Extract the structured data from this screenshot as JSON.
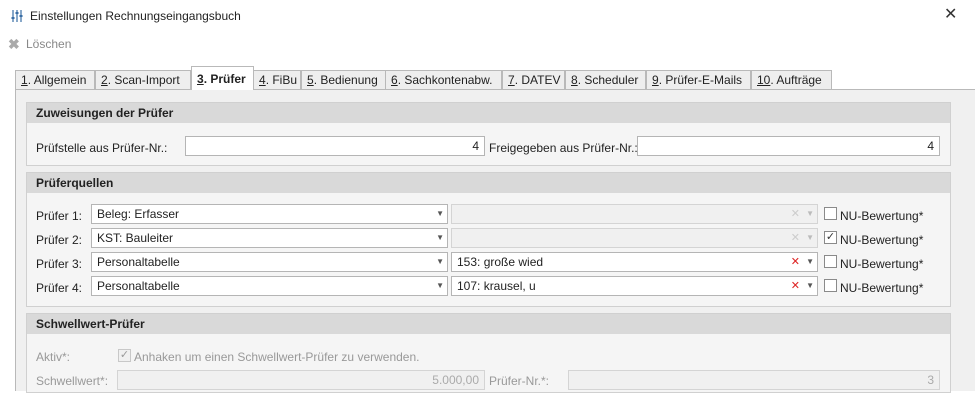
{
  "window": {
    "title": "Einstellungen Rechnungseingangsbuch",
    "title_icon": "settings-sliders-icon",
    "close_icon": "close-icon"
  },
  "toolbar": {
    "delete_label": "Löschen",
    "delete_icon": "close-x-icon"
  },
  "tabs": [
    {
      "key": "1",
      "rest": ". Allgemein",
      "active": false
    },
    {
      "key": "2",
      "rest": ". Scan-Import",
      "active": false
    },
    {
      "key": "3",
      "rest": ". Prüfer",
      "active": true
    },
    {
      "key": "4",
      "rest": ". FiBu",
      "active": false
    },
    {
      "key": "5",
      "rest": ". Bedienung",
      "active": false
    },
    {
      "key": "6",
      "rest": ". Sachkontenabw.",
      "active": false
    },
    {
      "key": "7",
      "rest": ". DATEV",
      "active": false
    },
    {
      "key": "8",
      "rest": ". Scheduler",
      "active": false
    },
    {
      "key": "9",
      "rest": ". Prüfer-E-Mails",
      "active": false
    },
    {
      "key": "10",
      "rest": ". Aufträge",
      "active": false
    }
  ],
  "zuweisungen": {
    "header": "Zuweisungen der Prüfer",
    "pruefstelle_label": "Prüfstelle aus Prüfer-Nr.:",
    "pruefstelle_value": "4",
    "freigegeben_label": "Freigegeben aus Prüfer-Nr.:",
    "freigegeben_value": "4"
  },
  "pruefquellen": {
    "header": "Prüferquellen",
    "rows": [
      {
        "label": "Prüfer 1:",
        "source": "Beleg: Erfasser",
        "value": "",
        "value_enabled": false,
        "nu_label": "NU-Bewertung*",
        "nu_checked": false
      },
      {
        "label": "Prüfer 2:",
        "source": "KST: Bauleiter",
        "value": "",
        "value_enabled": false,
        "nu_label": "NU-Bewertung*",
        "nu_checked": true
      },
      {
        "label": "Prüfer 3:",
        "source": "Personaltabelle",
        "value": "153: große wied",
        "value_enabled": true,
        "nu_label": "NU-Bewertung*",
        "nu_checked": false
      },
      {
        "label": "Prüfer 4:",
        "source": "Personaltabelle",
        "value": "107: krausel, u",
        "value_enabled": true,
        "nu_label": "NU-Bewertung*",
        "nu_checked": false
      }
    ]
  },
  "schwellwert": {
    "header": "Schwellwert-Prüfer",
    "aktiv_label": "Aktiv*:",
    "aktiv_checked": true,
    "aktiv_text": "Anhaken um einen Schwellwert-Prüfer zu verwenden.",
    "schwellwert_label": "Schwellwert*:",
    "schwellwert_value": "5.000,00",
    "pruefer_nr_label": "Prüfer-Nr.*:",
    "pruefer_nr_value": "3"
  }
}
